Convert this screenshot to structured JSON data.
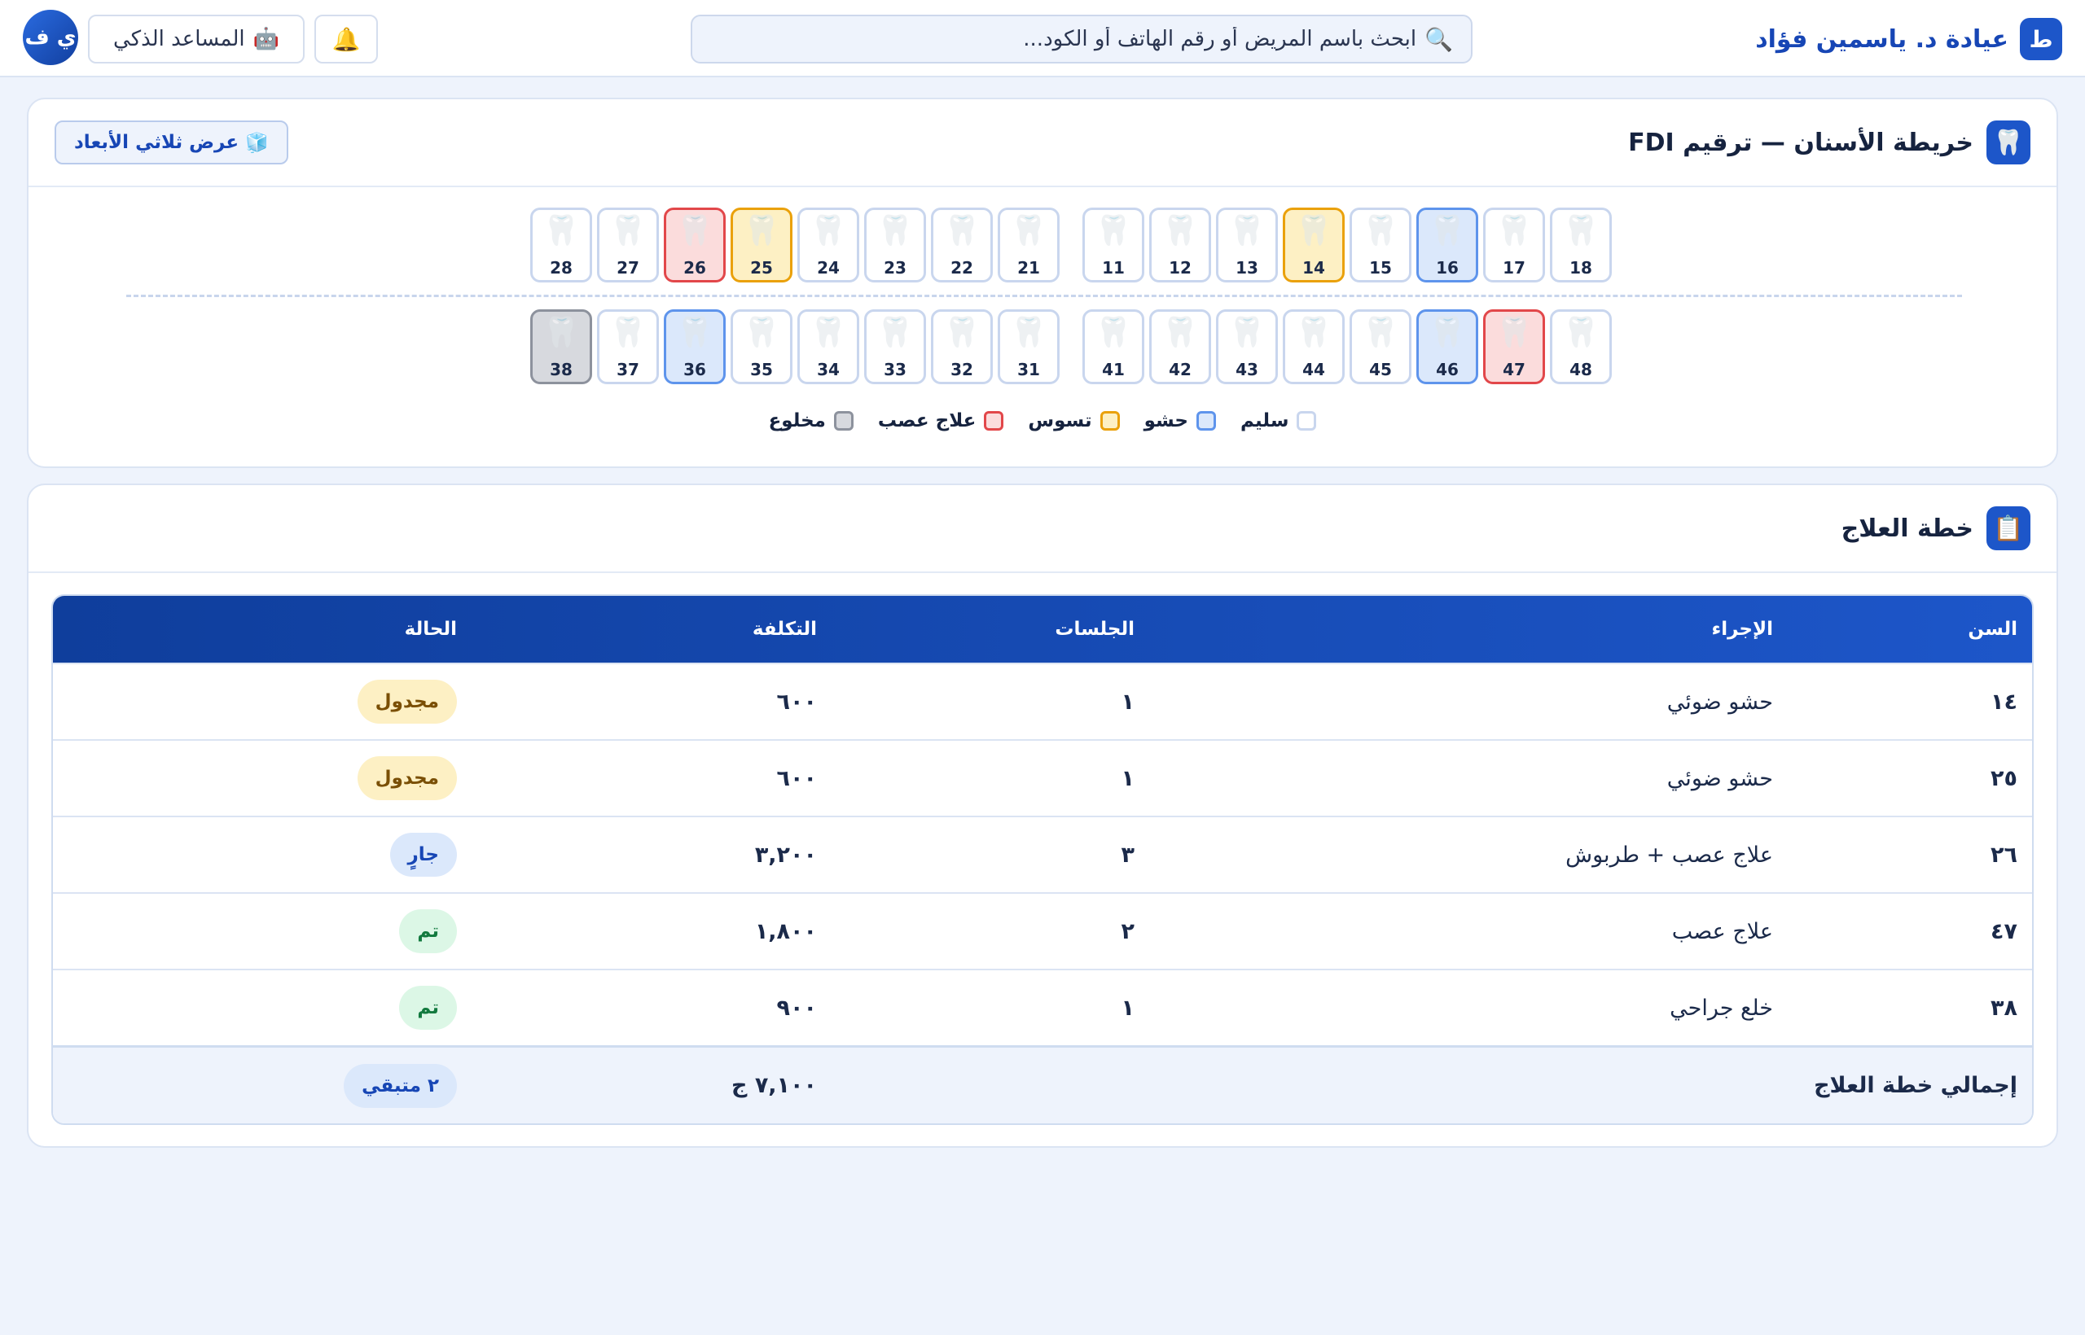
{
  "header": {
    "brand_logo": "ط",
    "brand_name": "عيادة د. ياسمين فؤاد",
    "search_placeholder": "ابحث باسم المريض أو رقم الهاتف أو الكود...",
    "search_icon": "magnifier-icon",
    "bell_icon": "bell-icon",
    "ai_assistant_label": "المساعد الذكي",
    "ai_icon": "robot-icon",
    "avatar_initials": "ي ف"
  },
  "dental_chart": {
    "title": "خريطة الأسنان — ترقيم FDI",
    "view_3d_label": "عرض ثلاثي الأبعاد",
    "upper_right": [
      {
        "num": "18",
        "state": "healthy"
      },
      {
        "num": "17",
        "state": "healthy"
      },
      {
        "num": "16",
        "state": "filling"
      },
      {
        "num": "15",
        "state": "healthy"
      },
      {
        "num": "14",
        "state": "caries"
      },
      {
        "num": "13",
        "state": "healthy"
      },
      {
        "num": "12",
        "state": "healthy"
      },
      {
        "num": "11",
        "state": "healthy"
      }
    ],
    "upper_left": [
      {
        "num": "21",
        "state": "healthy"
      },
      {
        "num": "22",
        "state": "healthy"
      },
      {
        "num": "23",
        "state": "healthy"
      },
      {
        "num": "24",
        "state": "healthy"
      },
      {
        "num": "25",
        "state": "caries"
      },
      {
        "num": "26",
        "state": "rct"
      },
      {
        "num": "27",
        "state": "healthy"
      },
      {
        "num": "28",
        "state": "healthy"
      }
    ],
    "lower_right": [
      {
        "num": "48",
        "state": "healthy"
      },
      {
        "num": "47",
        "state": "rct"
      },
      {
        "num": "46",
        "state": "filling"
      },
      {
        "num": "45",
        "state": "healthy"
      },
      {
        "num": "44",
        "state": "healthy"
      },
      {
        "num": "43",
        "state": "healthy"
      },
      {
        "num": "42",
        "state": "healthy"
      },
      {
        "num": "41",
        "state": "healthy"
      }
    ],
    "lower_left": [
      {
        "num": "31",
        "state": "healthy"
      },
      {
        "num": "32",
        "state": "healthy"
      },
      {
        "num": "33",
        "state": "healthy"
      },
      {
        "num": "34",
        "state": "healthy"
      },
      {
        "num": "35",
        "state": "healthy"
      },
      {
        "num": "36",
        "state": "filling"
      },
      {
        "num": "37",
        "state": "healthy"
      },
      {
        "num": "38",
        "state": "extract"
      }
    ],
    "legend": [
      {
        "label": "سليم",
        "state": "healthy"
      },
      {
        "label": "حشو",
        "state": "filling"
      },
      {
        "label": "تسوس",
        "state": "caries"
      },
      {
        "label": "علاج عصب",
        "state": "rct"
      },
      {
        "label": "مخلوع",
        "state": "extract"
      }
    ]
  },
  "treatment_plan": {
    "title": "خطة العلاج",
    "columns": {
      "tooth": "السن",
      "procedure": "الإجراء",
      "sessions": "الجلسات",
      "cost": "التكلفة",
      "status": "الحالة"
    },
    "rows": [
      {
        "tooth": "١٤",
        "procedure": "حشو ضوئي",
        "sessions": "١",
        "cost": "٦٠٠",
        "status": "مجدول",
        "status_type": "scheduled"
      },
      {
        "tooth": "٢٥",
        "procedure": "حشو ضوئي",
        "sessions": "١",
        "cost": "٦٠٠",
        "status": "مجدول",
        "status_type": "scheduled"
      },
      {
        "tooth": "٢٦",
        "procedure": "علاج عصب + طربوش",
        "sessions": "٣",
        "cost": "٣,٢٠٠",
        "status": "جارٍ",
        "status_type": "progress"
      },
      {
        "tooth": "٤٧",
        "procedure": "علاج عصب",
        "sessions": "٢",
        "cost": "١,٨٠٠",
        "status": "تم",
        "status_type": "done"
      },
      {
        "tooth": "٣٨",
        "procedure": "خلع جراحي",
        "sessions": "١",
        "cost": "٩٠٠",
        "status": "تم",
        "status_type": "done"
      }
    ],
    "footer": {
      "label": "إجمالي خطة العلاج",
      "total_cost": "٧,١٠٠ ج",
      "remaining": "٢ متبقي"
    }
  }
}
